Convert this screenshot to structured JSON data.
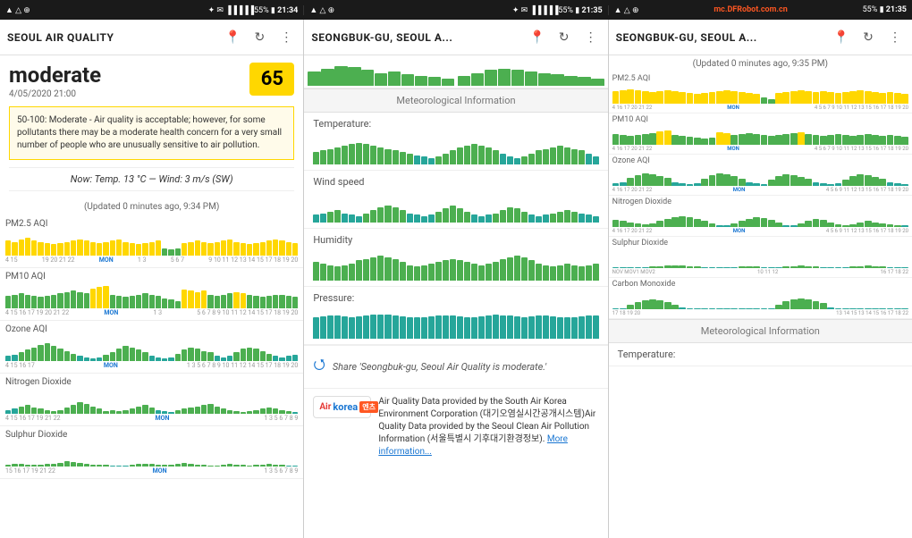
{
  "statusBar": [
    {
      "left": "▲ △ ⊕",
      "right": "🔵 ✉ 55% 🔋 21:34",
      "time": "21:34"
    },
    {
      "left": "▲ △ ⊕",
      "right": "🔵 ✉ 55% 🔋 21:35",
      "time": "21:35"
    },
    {
      "left": "▲ △",
      "right": "55% 🔋 21:35",
      "time": "21:35"
    }
  ],
  "panels": [
    {
      "id": "panel-left",
      "title": "SEOUL AIR QUALITY",
      "aqi": {
        "label": "moderate",
        "date": "4/05/2020 21:00",
        "value": "65",
        "description": "50-100: Moderate - Air quality is acceptable; however, for some pollutants there may be a moderate health concern for a very small number of people who are unusually sensitive to air pollution."
      },
      "weather": "Now:  Temp.  13 °C — Wind:  3 m/s (SW)",
      "updated": "(Updated 0 minutes ago, 9:34 PM)",
      "charts": [
        {
          "label": "PM2.5 AQI",
          "type": "mixed-yellow-green"
        },
        {
          "label": "PM10 AQI",
          "type": "mixed-yellow-green2"
        },
        {
          "label": "Ozone AQI",
          "type": "green-wave"
        },
        {
          "label": "Nitrogen Dioxide",
          "type": "green-small"
        },
        {
          "label": "Sulphur Dioxide",
          "type": "bottom"
        }
      ]
    },
    {
      "id": "panel-middle",
      "title": "SEONGBUK-GU, SEOUL A...",
      "section_label": "Meteorological Information",
      "met_rows": [
        {
          "label": "Temperature:"
        },
        {
          "label": "Wind speed"
        },
        {
          "label": "Humidity"
        },
        {
          "label": "Pressure:"
        }
      ],
      "share_text": "Share 'Seongbuk-gu, Seoul Air Quality is moderate.'",
      "provider_text": "Air Quality Data provided by the South Air Korea Environment Corporation (대기오염실시간공개시스템)Air Quality Data provided by the Seoul Clean Air Pollution Information (서울특별시 기후대기환경정보).",
      "more_link": "More information..."
    },
    {
      "id": "panel-right",
      "title": "SEONGBUK-GU, SEOUL A...",
      "updated": "(Updated 0 minutes ago, 9:35 PM)",
      "charts": [
        {
          "label": "PM2.5 AQI",
          "type": "yellow-dense"
        },
        {
          "label": "PM10 AQI",
          "type": "green-mixed"
        },
        {
          "label": "Ozone AQI",
          "type": "green-wave2"
        },
        {
          "label": "Nitrogen Dioxide",
          "type": "green-sparse"
        },
        {
          "label": "Sulphur Dioxide",
          "type": "tiny-sparse"
        },
        {
          "label": "Carbon Monoxide",
          "type": "sparse-left"
        }
      ],
      "section_label": "Meteorological Information",
      "met_label": "Temperature:"
    }
  ],
  "watermark": "mc.DFRobot.com.cn"
}
